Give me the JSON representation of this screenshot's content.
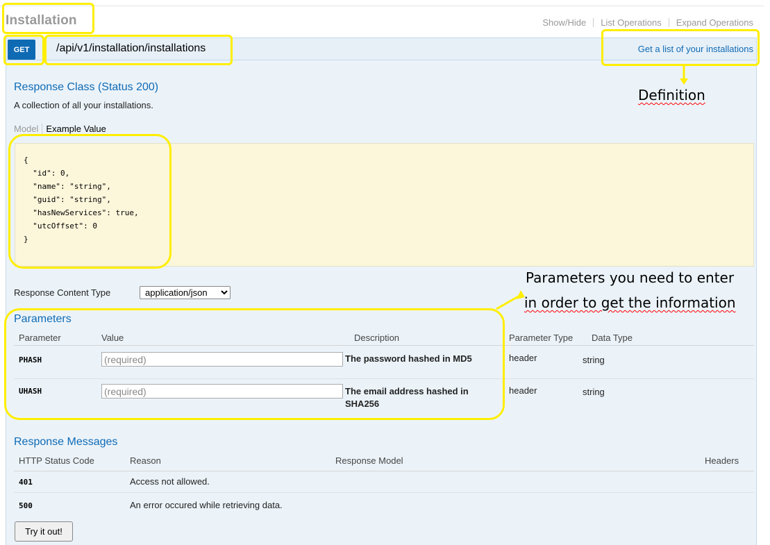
{
  "header": {
    "title": "Installation",
    "links": [
      "Show/Hide",
      "List Operations",
      "Expand Operations"
    ]
  },
  "endpoint": {
    "method": "GET",
    "path": "/api/v1/installation/installations",
    "summary": "Get a list of your installations"
  },
  "response_class": {
    "heading": "Response Class (Status 200)",
    "description": "A collection of all your installations.",
    "tab_model": "Model",
    "tab_example": "Example Value",
    "example_json": "{\n  \"id\": 0,\n  \"name\": \"string\",\n  \"guid\": \"string\",\n  \"hasNewServices\": true,\n  \"utcOffset\": 0\n}"
  },
  "content_type": {
    "label": "Response Content Type",
    "selected": "application/json"
  },
  "parameters": {
    "heading": "Parameters",
    "columns": [
      "Parameter",
      "Value",
      "Description",
      "Parameter Type",
      "Data Type"
    ],
    "rows": [
      {
        "name": "PHASH",
        "placeholder": "(required)",
        "description": "The password hashed in MD5",
        "param_type": "header",
        "data_type": "string"
      },
      {
        "name": "UHASH",
        "placeholder": "(required)",
        "description": "The email address hashed in SHA256",
        "param_type": "header",
        "data_type": "string"
      }
    ]
  },
  "response_messages": {
    "heading": "Response Messages",
    "columns": [
      "HTTP Status Code",
      "Reason",
      "Response Model",
      "Headers"
    ],
    "rows": [
      {
        "code": "401",
        "reason": "Access not allowed."
      },
      {
        "code": "500",
        "reason": "An error occured while retrieving data."
      }
    ]
  },
  "try_button": "Try it out!",
  "annotations": {
    "definition": "Definition",
    "params_line1": "Parameters you need to enter",
    "params_line2": "in order to get the information",
    "highlight_color": "#ffee00"
  }
}
